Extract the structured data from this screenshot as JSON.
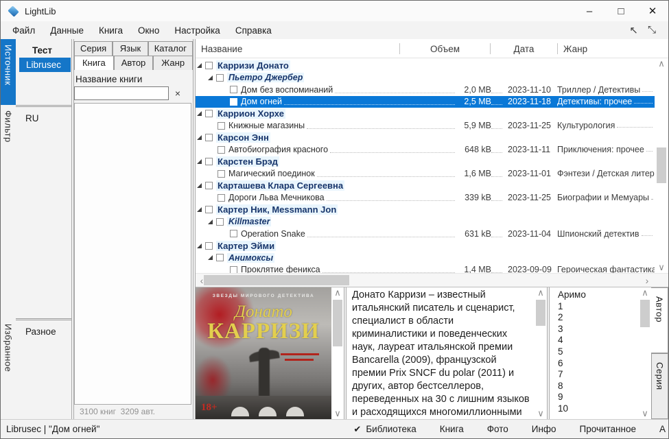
{
  "window": {
    "title": "LightLib"
  },
  "icons": {
    "window_min": "–",
    "window_max": "□",
    "window_close": "✕",
    "collapse": "↖",
    "expand": "⤡",
    "clear": "×",
    "check": "✔",
    "up": "∧",
    "down": "∨",
    "left": "‹",
    "right": "›"
  },
  "menu": {
    "items": [
      "Файл",
      "Данные",
      "Книга",
      "Окно",
      "Настройка",
      "Справка"
    ]
  },
  "sidebar": {
    "sections": [
      {
        "label": "Источник",
        "active": true,
        "items": [
          {
            "label": "Тест",
            "style": "bold"
          },
          {
            "label": "Librusec",
            "style": "sel"
          }
        ]
      },
      {
        "label": "Фильтр",
        "active": false,
        "items": [
          {
            "label": "RU",
            "style": ""
          }
        ]
      },
      {
        "label": "Избранное",
        "active": false,
        "items": [
          {
            "label": "Разное",
            "style": ""
          }
        ]
      }
    ]
  },
  "filter_panel": {
    "tab_row1": [
      "Серия",
      "Язык",
      "Каталог"
    ],
    "tab_row2": [
      "Книга",
      "Автор",
      "Жанр"
    ],
    "active_tab": "Книга",
    "field_label": "Название книги",
    "input_value": "",
    "footer": "3100 книг  3209 авт."
  },
  "tree": {
    "columns": [
      "Название",
      "Объем",
      "Дата",
      "Жанр"
    ],
    "rows": [
      {
        "type": "author",
        "level": 0,
        "title": "Карризи Донато",
        "expanded": true
      },
      {
        "type": "series",
        "level": 1,
        "title": "Пьетро Джербер",
        "expanded": true
      },
      {
        "type": "book",
        "level": 2,
        "title": "Дом без воспоминаний",
        "size": "2,0 MB",
        "date": "2023-11-10",
        "genre": "Триллер / Детективы"
      },
      {
        "type": "book",
        "level": 2,
        "title": "Дом огней",
        "size": "2,5 MB",
        "date": "2023-11-18",
        "genre": "Детективы: прочее",
        "selected": true
      },
      {
        "type": "author",
        "level": 0,
        "title": "Каррион Хорхе",
        "expanded": true
      },
      {
        "type": "book",
        "level": 1,
        "title": "Книжные магазины",
        "size": "5,9 MB",
        "date": "2023-11-25",
        "genre": "Культурология"
      },
      {
        "type": "author",
        "level": 0,
        "title": "Карсон Энн",
        "expanded": true
      },
      {
        "type": "book",
        "level": 1,
        "title": "Автобиография красного",
        "size": "648 kB",
        "date": "2023-11-11",
        "genre": "Приключения: прочее"
      },
      {
        "type": "author",
        "level": 0,
        "title": "Карстен Брэд",
        "expanded": true
      },
      {
        "type": "book",
        "level": 1,
        "title": "Магический поединок",
        "size": "1,6 MB",
        "date": "2023-11-01",
        "genre": "Фэнтези / Детская литература"
      },
      {
        "type": "author",
        "level": 0,
        "title": "Карташева Клара Сергеевна",
        "expanded": true
      },
      {
        "type": "book",
        "level": 1,
        "title": "Дороги Льва Мечникова",
        "size": "339 kB",
        "date": "2023-11-25",
        "genre": "Биографии и Мемуары"
      },
      {
        "type": "author",
        "level": 0,
        "title": "Картер Ник, Messmann Jon",
        "expanded": true
      },
      {
        "type": "series",
        "level": 1,
        "title": "Killmaster",
        "expanded": true
      },
      {
        "type": "book",
        "level": 2,
        "title": "Operation Snake",
        "size": "631 kB",
        "date": "2023-11-04",
        "genre": "Шпионский детектив"
      },
      {
        "type": "author",
        "level": 0,
        "title": "Картер Эйми",
        "expanded": true
      },
      {
        "type": "series",
        "level": 1,
        "title": "Анимоксы",
        "expanded": true
      },
      {
        "type": "book",
        "level": 2,
        "title": "Проклятие феникса",
        "size": "1,4 MB",
        "date": "2023-09-09",
        "genre": "Героическая фантастика"
      }
    ]
  },
  "preview": {
    "cover": {
      "series_caption": "ЗВЕЗДЫ МИРОВОГО ДЕТЕКТИВА",
      "author_line1": "Донато",
      "author_line2": "КАРРИЗИ",
      "age_badge": "18+"
    },
    "description": "Донато Карризи – известный итальянский писатель и сценарист, специалист в области криминалистики и поведенческих наук, лауреат итальянской премии Bancarella (2009), французской премии Prix SNCF du polar (2011) и других, автор бестселлеров, переведенных на 30 с лишним языков и расходящихся многомиллионными тиражами. Три"
  },
  "series_list": {
    "items": [
      "Аримо",
      "1",
      "2",
      "3",
      "4",
      "5",
      "6",
      "7",
      "8",
      "9",
      "10"
    ],
    "tabs": [
      {
        "label": "Автор",
        "active": true
      },
      {
        "label": "Серия",
        "active": false
      }
    ]
  },
  "statusbar": {
    "left": "Librusec | \"Дом огней\"",
    "toggles": [
      {
        "label": "Библиотека",
        "checked": true
      },
      {
        "label": "Книга",
        "checked": false
      },
      {
        "label": "Фото",
        "checked": false
      },
      {
        "label": "Инфо",
        "checked": false
      },
      {
        "label": "Прочитанное",
        "checked": false
      },
      {
        "label": "А",
        "checked": false
      }
    ]
  },
  "colors": {
    "accent": "#0a78d7",
    "sidebar_accent": "#1576c8",
    "author_text": "#17356b",
    "selected_text": "#ffffff"
  }
}
